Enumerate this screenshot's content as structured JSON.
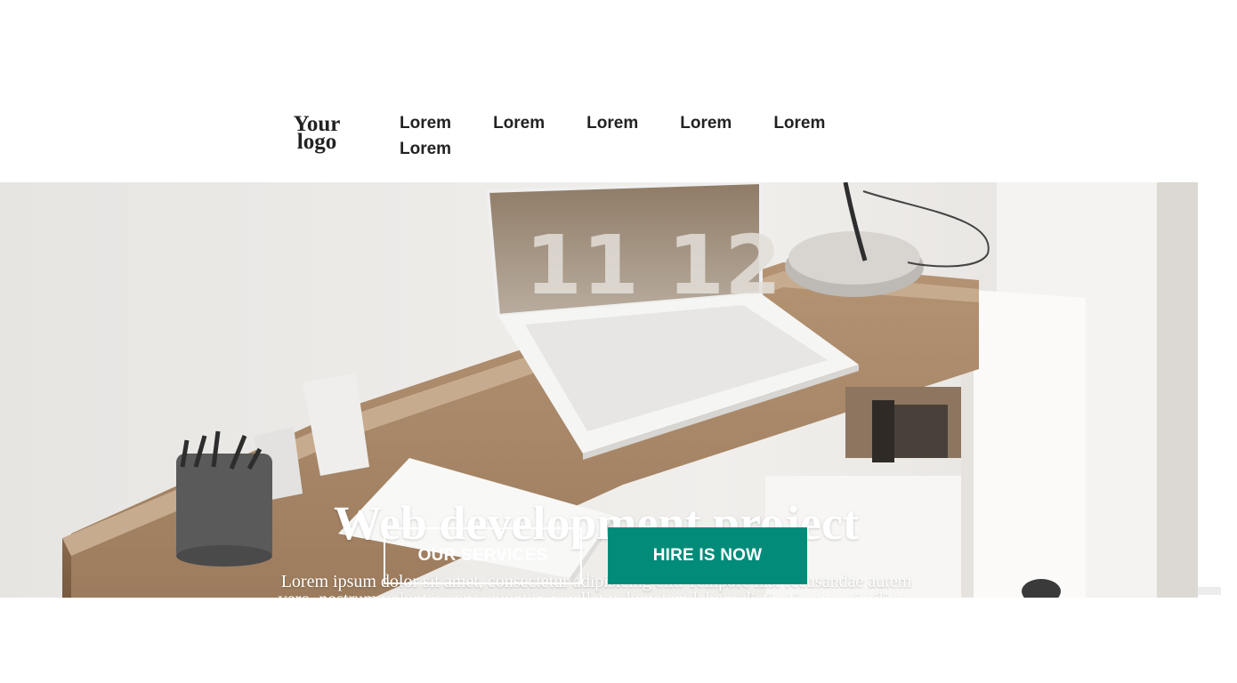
{
  "header": {
    "logo_line1": "Your",
    "logo_line2": "logo",
    "nav": [
      "Lorem",
      "Lorem",
      "Lorem",
      "Lorem",
      "Lorem",
      "Lorem"
    ]
  },
  "hero": {
    "title": "Web development project",
    "text": "Lorem ipsum dolor sit amet, consectetur adipisicing elit. Tempore nisi recusandae autem vero, nostrum voluptas consequuntur, repellat voluptatem labore distinctio quo, similique sunt aliquid odio laborum atque sequi enim amet.",
    "screen_clock": "11 12",
    "buttons": {
      "services": "OUR SERVICES",
      "hire": "HIRE IS NOW"
    }
  },
  "colors": {
    "accent": "#008c79",
    "text_dark": "#222222",
    "wood": "#a98a6c"
  }
}
